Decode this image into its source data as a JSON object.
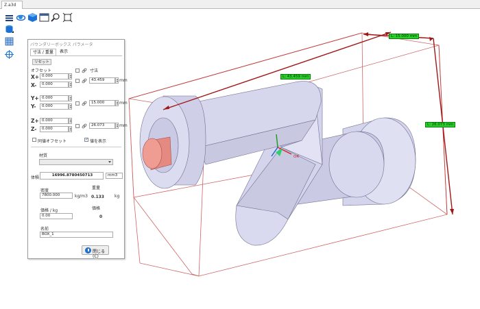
{
  "window": {
    "tab_title": "Z.a3d"
  },
  "toolbar": {
    "items": [
      "menu-icon",
      "orbit-icon",
      "cube-view-icon",
      "window-icon",
      "zoom-icon",
      "fit-icon"
    ],
    "left_tools": [
      "layers-icon",
      "grid-icon",
      "crosshair-icon"
    ]
  },
  "panel": {
    "title": "バウンダリーボックス パラメータ",
    "tabs": [
      "寸法 / 重量",
      "表示"
    ],
    "reset_label": "リセット",
    "offset_label": "オフセット",
    "size_label": "寸法",
    "x_plus_label": "X+",
    "x_minus_label": "X-",
    "y_plus_label": "Y+",
    "y_minus_label": "Y-",
    "z_plus_label": "Z+",
    "z_minus_label": "Z-",
    "x_plus": "0.000",
    "x_minus": "0.000",
    "y_plus": "0.000",
    "y_minus": "0.000",
    "z_plus": "0.000",
    "z_minus": "0.000",
    "size_x": "43.459",
    "size_y": "15.000",
    "size_z": "26.073",
    "unit_mm": "mm",
    "same_offset_label": "同値オフセット",
    "show_values_label": "値を表示",
    "show_values_checked": true,
    "material_label": "材質",
    "material_value": "",
    "volume_label": "体積",
    "volume_value": "16996.8780450713",
    "volume_unit": "mm3",
    "density_label": "密度",
    "density_value": "7800.000",
    "density_unit": "kg/m3",
    "weight_label": "重量",
    "weight_value": "0.133",
    "weight_unit": "kg",
    "price_per_kg_label": "価格 / kg",
    "price_per_kg_value": "0.00",
    "price_label": "価格",
    "price_value": "0",
    "name_label": "名前",
    "name_value": "BOX_1",
    "close_label": "閉じる(C)"
  },
  "dimensions": {
    "width_label": "L: 15.000 mm",
    "length_label": "L: 43.459 mm",
    "height_label": "L: 26.073 mm"
  },
  "colors": {
    "box_line": "#c23a3a",
    "dim_line": "#a01616",
    "dim_label_bg": "#2bd12b",
    "part_fill": "#d4d4ec",
    "part_shadow": "#a9a9c9",
    "flange_fill": "#e58a80"
  }
}
